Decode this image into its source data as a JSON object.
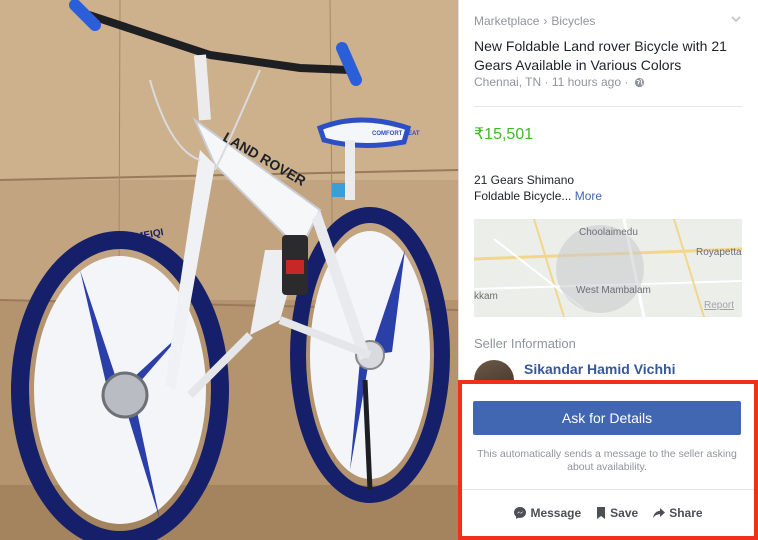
{
  "breadcrumb": {
    "root": "Marketplace",
    "separator": "›",
    "category": "Bicycles"
  },
  "listing": {
    "title": "New Foldable Land rover Bicycle with 21 Gears Available in Various Colors",
    "location": "Chennai, TN",
    "time": "11 hours ago",
    "price": "₹15,501",
    "description_line1": "21 Gears Shimano",
    "description_line2": "Foldable Bicycle...",
    "more_label": "More"
  },
  "photo_text": {
    "frame_brand": "LAND ROVER",
    "rim_brand": "MEIQI",
    "saddle_brand": "COMFORT SEAT"
  },
  "map": {
    "labels": [
      "Choolaimedu",
      "Royapetta",
      "kkam",
      "West Mambalam"
    ],
    "report_label": "Report"
  },
  "seller": {
    "heading": "Seller Information",
    "name": "Sikandar Hamid Vichhi"
  },
  "cta": {
    "button": "Ask for Details",
    "note": "This automatically sends a message to the seller asking about availability."
  },
  "actions": {
    "message": "Message",
    "save": "Save",
    "share": "Share"
  },
  "colors": {
    "price_green": "#42b72a",
    "fb_blue": "#4267b2",
    "highlight_red": "#f0301d",
    "link_blue": "#365899"
  }
}
